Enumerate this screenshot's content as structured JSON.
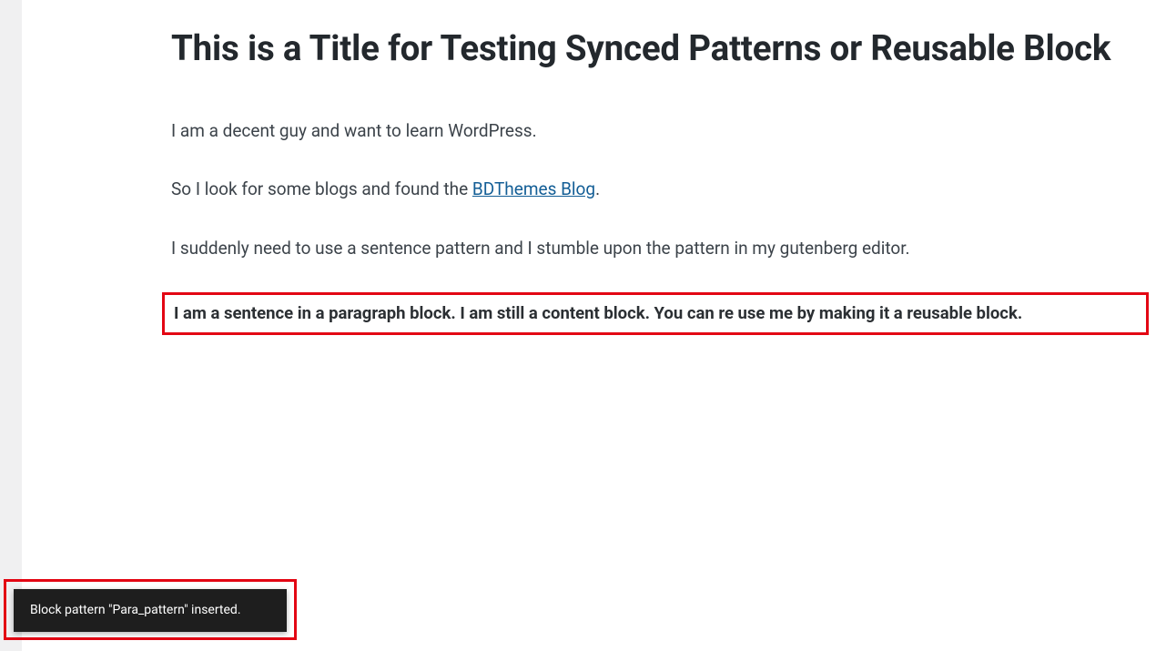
{
  "post": {
    "title": "This is a Title for Testing Synced Patterns or Reusable Block",
    "para1": "I am a decent guy and want to learn WordPress.",
    "para2_prefix": "So I look for some blogs and found the ",
    "para2_link_text": "BDThemes Blog",
    "para2_suffix": ".",
    "para3": "I suddenly need to use a sentence pattern and I stumble upon the pattern in my gutenberg editor.",
    "pattern_paragraph": "I am a sentence in a paragraph block. I am still a content block. You can  re use me by making it a reusable block."
  },
  "toast": {
    "message": "Block pattern \"Para_pattern\" inserted."
  },
  "colors": {
    "highlight_border": "#e30613",
    "link": "#135e96",
    "toast_bg": "#1e1e1e"
  }
}
